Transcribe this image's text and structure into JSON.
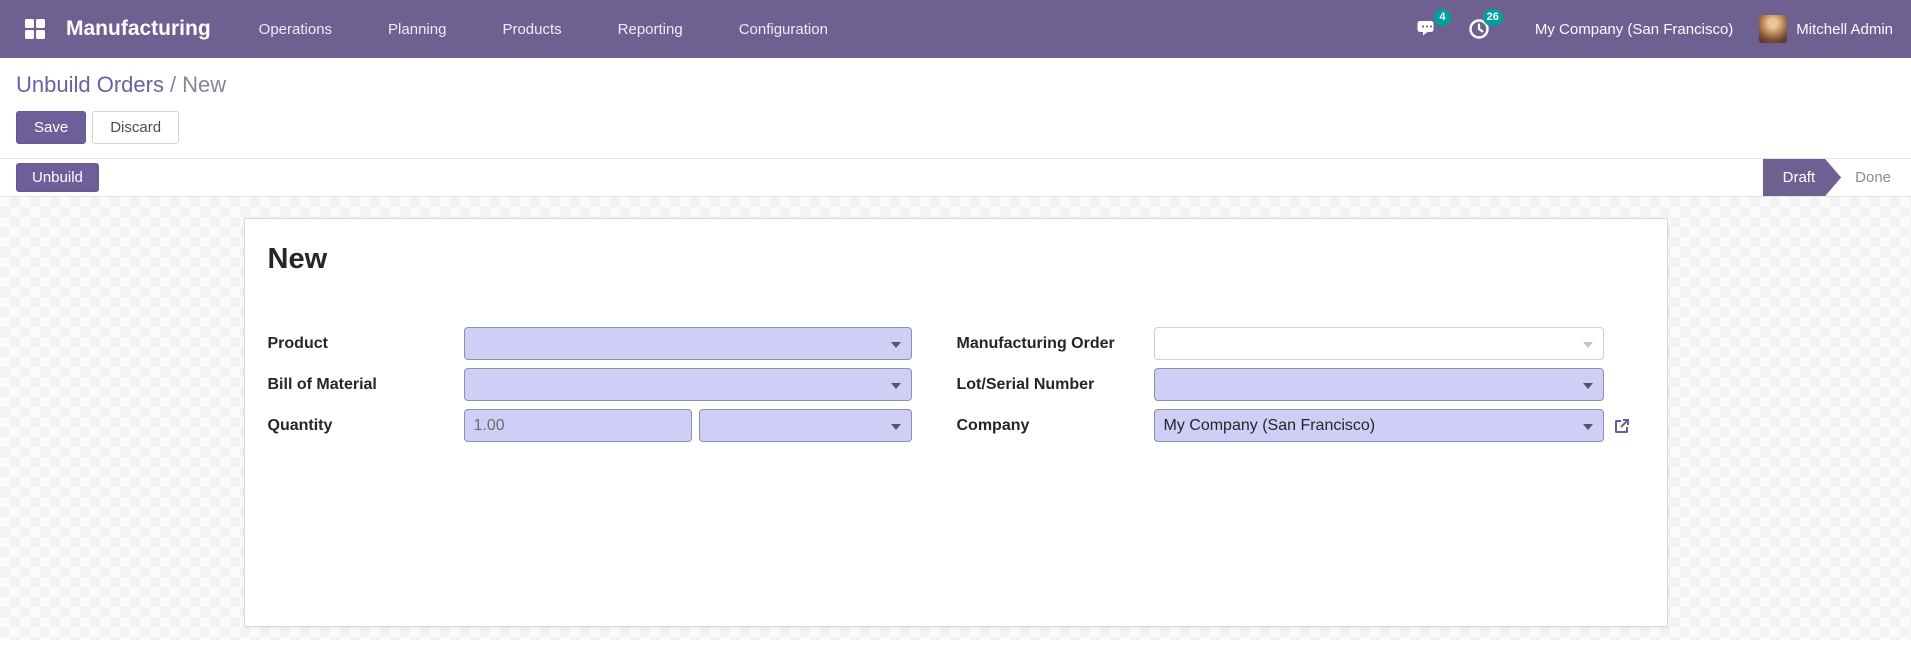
{
  "navbar": {
    "app_name": "Manufacturing",
    "menus": [
      "Operations",
      "Planning",
      "Products",
      "Reporting",
      "Configuration"
    ],
    "messages_count": "4",
    "activities_count": "26",
    "company": "My Company (San Francisco)",
    "user": "Mitchell Admin"
  },
  "breadcrumb": {
    "parent": "Unbuild Orders",
    "separator": "/",
    "current": "New"
  },
  "actions": {
    "save": "Save",
    "discard": "Discard"
  },
  "statusbar": {
    "unbuild": "Unbuild",
    "draft": "Draft",
    "done": "Done"
  },
  "form": {
    "title": "New",
    "product_label": "Product",
    "bom_label": "Bill of Material",
    "quantity_label": "Quantity",
    "quantity_value": "1.00",
    "mo_label": "Manufacturing Order",
    "lot_label": "Lot/Serial Number",
    "company_label": "Company",
    "company_value": "My Company (San Francisco)"
  },
  "colors": {
    "navbar_bg": "#6e6192",
    "primary_button": "#6e5f9b",
    "badge": "#00a09d",
    "field_bg": "#cfcef7",
    "breadcrumb_link": "#6d5fa0"
  }
}
